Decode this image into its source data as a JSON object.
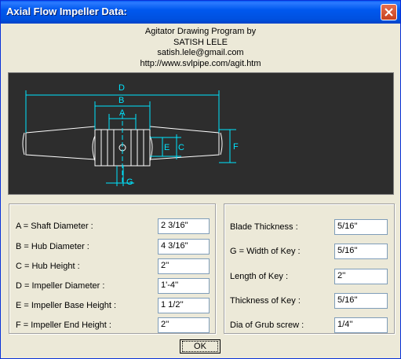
{
  "window": {
    "title": "Axial Flow Impeller Data:"
  },
  "credits": {
    "line1": "Agitator Drawing Program by",
    "line2": "SATISH LELE",
    "line3": "satish.lele@gmail.com",
    "line4": "http://www.svlpipe.com/agit.htm"
  },
  "drawing": {
    "labels": {
      "d": "D",
      "b": "B",
      "a": "A",
      "c": "C",
      "e": "E",
      "f": "F",
      "g": "G"
    },
    "colors": {
      "background": "#2D2D2D",
      "dimension": "#00E5FF",
      "outline": "#FFFFFF"
    }
  },
  "left_fields": [
    {
      "label": "A = Shaft Diameter :",
      "value": "2 3/16''"
    },
    {
      "label": "B = Hub Diameter :",
      "value": "4 3/16''"
    },
    {
      "label": "C = Hub Height  :",
      "value": "2''"
    },
    {
      "label": "D = Impeller Diameter  :",
      "value": "1'-4''"
    },
    {
      "label": "E = Impeller Base Height  :",
      "value": "1 1/2''"
    },
    {
      "label": "F = Impeller End Height  :",
      "value": "2''"
    }
  ],
  "right_fields": [
    {
      "label": "Blade Thickness  :",
      "value": "5/16''"
    },
    {
      "label": "G = Width of Key  :",
      "value": "5/16''"
    },
    {
      "label": "Length of Key  :",
      "value": "2''"
    },
    {
      "label": "Thickness of Key  :",
      "value": "5/16''"
    },
    {
      "label": "Dia of Grub screw  :",
      "value": "1/4''"
    }
  ],
  "buttons": {
    "ok": "OK"
  }
}
